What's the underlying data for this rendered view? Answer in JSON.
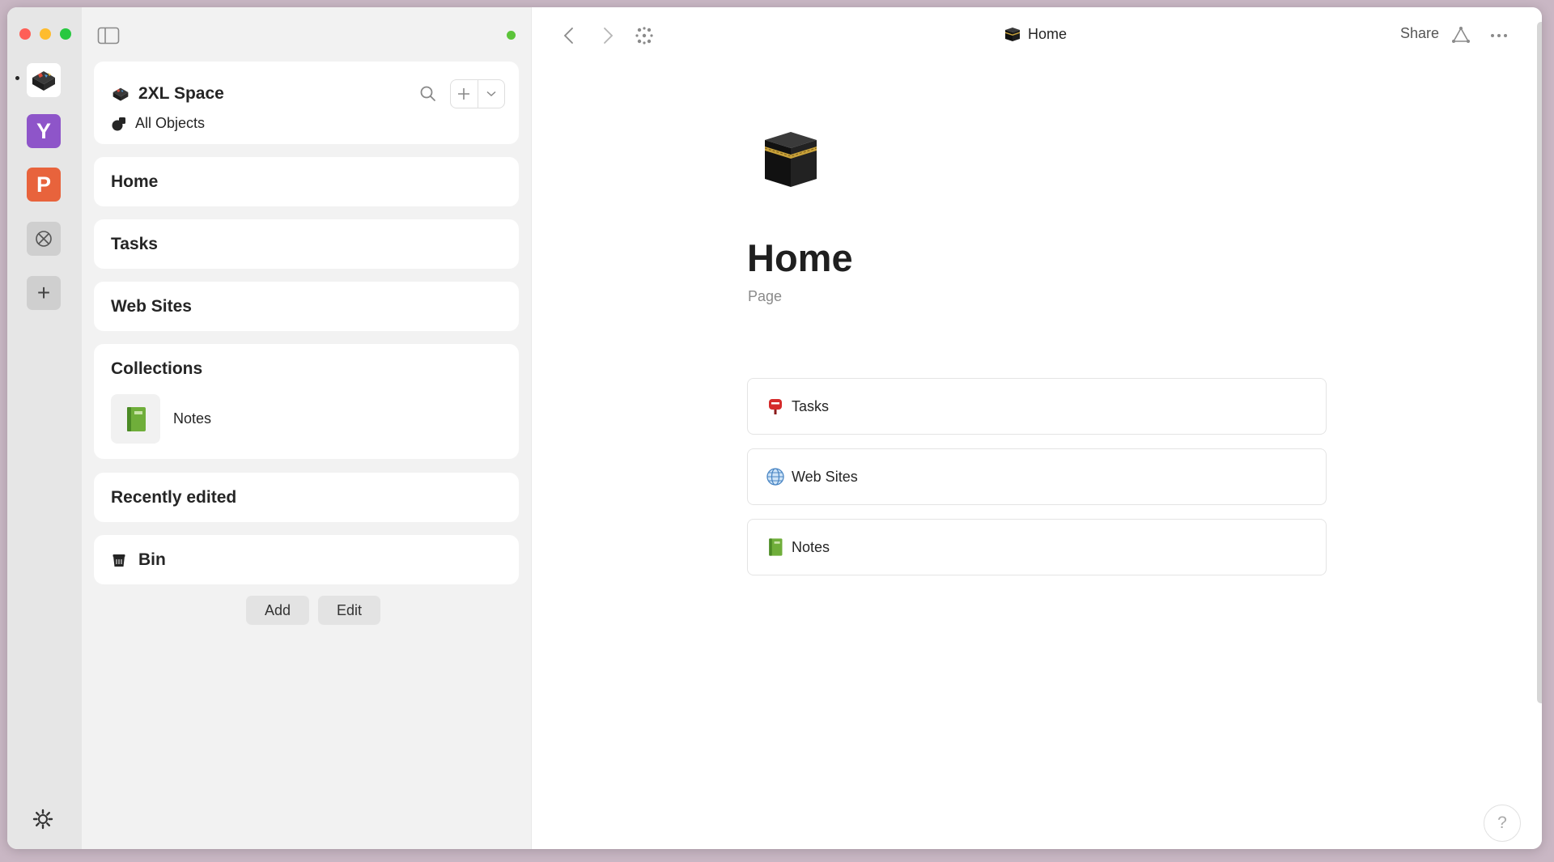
{
  "rail": {
    "spaces": [
      {
        "letter": "",
        "name": "2XL Space",
        "color": "#ffffff"
      },
      {
        "letter": "Y",
        "color": "#8e55c9"
      },
      {
        "letter": "P",
        "color": "#e8633c"
      }
    ],
    "add_label": "+"
  },
  "sidebar": {
    "space_name": "2XL Space",
    "all_objects": "All Objects",
    "items": {
      "home": "Home",
      "tasks": "Tasks",
      "web_sites": "Web Sites",
      "recently_edited": "Recently edited",
      "bin": "Bin"
    },
    "collections": {
      "title": "Collections",
      "items": [
        "Notes"
      ]
    },
    "add_button": "Add",
    "edit_button": "Edit",
    "sync_color": "#5cc43a"
  },
  "main": {
    "header_title": "Home",
    "share_label": "Share",
    "page_title": "Home",
    "page_type": "Page",
    "links": [
      {
        "label": "Tasks",
        "icon": "postbox-icon"
      },
      {
        "label": "Web Sites",
        "icon": "globe-icon"
      },
      {
        "label": "Notes",
        "icon": "green-book-icon"
      }
    ],
    "help_label": "?"
  }
}
